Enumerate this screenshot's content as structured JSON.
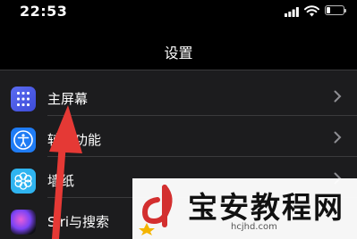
{
  "status_bar": {
    "time": "22:53"
  },
  "header": {
    "title": "设置"
  },
  "settings": {
    "items": [
      {
        "label": "主屏幕",
        "icon": "home-screen-grid-icon"
      },
      {
        "label": "辅助功能",
        "icon": "accessibility-person-icon"
      },
      {
        "label": "墙纸",
        "icon": "wallpaper-flower-icon"
      },
      {
        "label": "Siri与搜索",
        "icon": "siri-icon"
      }
    ]
  },
  "watermark": {
    "text": "宝安教程网",
    "url": "hcjhd.com"
  },
  "colors": {
    "background": "#000000",
    "list": "#1c1c1e",
    "annotation_arrow": "#e53935"
  }
}
